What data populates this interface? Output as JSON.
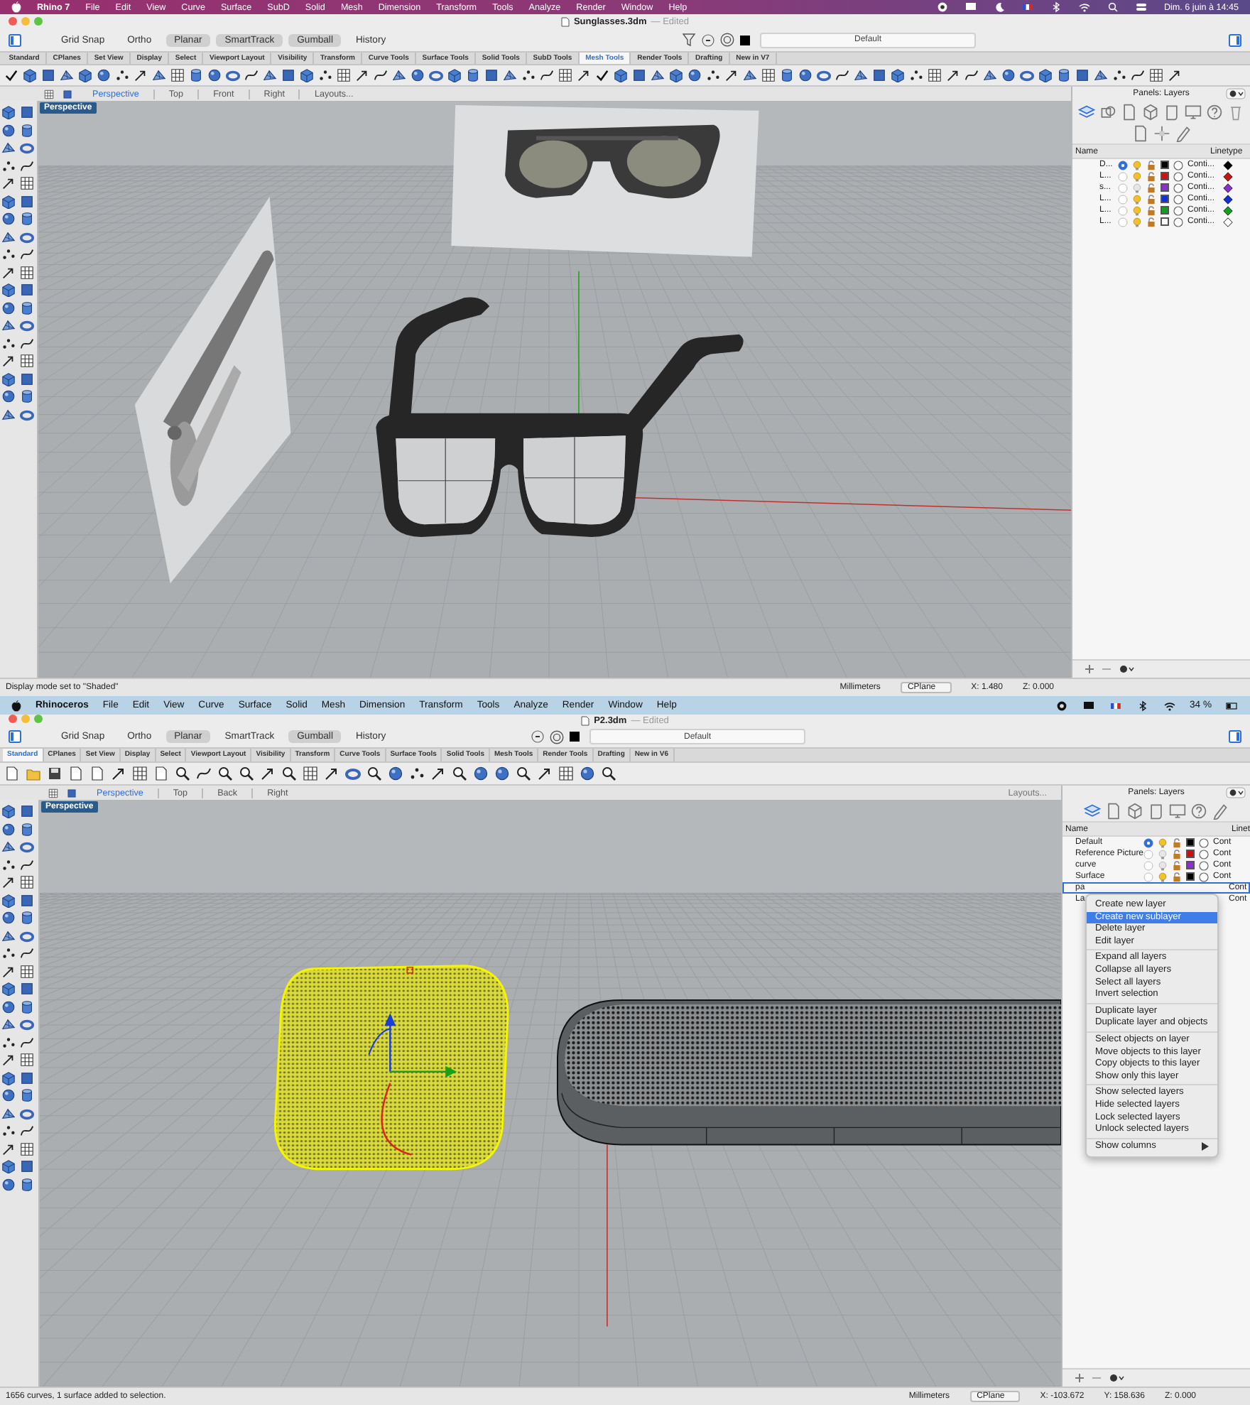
{
  "windows": [
    {
      "kind": "rhino7",
      "menu_bar": {
        "items": [
          "Rhino 7",
          "File",
          "Edit",
          "View",
          "Curve",
          "Surface",
          "SubD",
          "Solid",
          "Mesh",
          "Dimension",
          "Transform",
          "Tools",
          "Analyze",
          "Render",
          "Window",
          "Help"
        ],
        "clock": "Dim. 6 juin à 14:45"
      },
      "title": "Sunglasses.3dm",
      "title_note": "— Edited",
      "toggles": [
        {
          "label": "Grid Snap",
          "on": false
        },
        {
          "label": "Ortho",
          "on": false
        },
        {
          "label": "Planar",
          "on": true
        },
        {
          "label": "SmartTrack",
          "on": true
        },
        {
          "label": "Gumball",
          "on": true
        },
        {
          "label": "History",
          "on": false
        }
      ],
      "layer_field": "Default",
      "toolbar_tabs": [
        {
          "label": "Standard",
          "selected": false
        },
        {
          "label": "CPlanes",
          "selected": false
        },
        {
          "label": "Set View",
          "selected": false
        },
        {
          "label": "Display",
          "selected": false
        },
        {
          "label": "Select",
          "selected": false
        },
        {
          "label": "Viewport Layout",
          "selected": false
        },
        {
          "label": "Visibility",
          "selected": false
        },
        {
          "label": "Transform",
          "selected": false
        },
        {
          "label": "Curve Tools",
          "selected": false
        },
        {
          "label": "Surface Tools",
          "selected": false
        },
        {
          "label": "Solid Tools",
          "selected": false
        },
        {
          "label": "SubD Tools",
          "selected": false
        },
        {
          "label": "Mesh Tools",
          "selected": true
        },
        {
          "label": "Render Tools",
          "selected": false
        },
        {
          "label": "Drafting",
          "selected": false
        },
        {
          "label": "New in V7",
          "selected": false
        }
      ],
      "view_tabs": [
        {
          "label": "Perspective",
          "selected": true
        },
        {
          "label": "Top",
          "selected": false
        },
        {
          "label": "Front",
          "selected": false
        },
        {
          "label": "Right",
          "selected": false
        }
      ],
      "layouts_button": "Layouts...",
      "viewport": {
        "label": "Perspective",
        "kind": "glasses"
      },
      "panel": {
        "title": "Panels: Layers",
        "columns": [
          "Name",
          "Linetype"
        ],
        "rows": [
          {
            "name": "D...",
            "current": true,
            "visible": true,
            "color": "#000000",
            "linetype": "Conti..."
          },
          {
            "name": "L...",
            "current": false,
            "visible": true,
            "color": "#d01010",
            "linetype": "Conti..."
          },
          {
            "name": "s...",
            "current": false,
            "visible": false,
            "color": "#8a2fd0",
            "linetype": "Conti..."
          },
          {
            "name": "L...",
            "current": false,
            "visible": true,
            "color": "#1030e0",
            "linetype": "Conti..."
          },
          {
            "name": "L...",
            "current": false,
            "visible": true,
            "color": "#10a020",
            "linetype": "Conti..."
          },
          {
            "name": "L...",
            "current": false,
            "visible": true,
            "color": "#ffffff",
            "linetype": "Conti..."
          }
        ]
      },
      "status": {
        "message": "Display mode set to \"Shaded\"",
        "units": "Millimeters",
        "cplane": "CPlane",
        "coords": [
          "X: 1.480",
          "Z: 0.000"
        ]
      }
    },
    {
      "kind": "rhino6",
      "menu_bar": {
        "items": [
          "Rhinoceros",
          "File",
          "Edit",
          "View",
          "Curve",
          "Surface",
          "Solid",
          "Mesh",
          "Dimension",
          "Transform",
          "Tools",
          "Analyze",
          "Render",
          "Window",
          "Help"
        ],
        "battery": "34 %"
      },
      "title": "P2.3dm",
      "title_note": "— Edited",
      "toggles": [
        {
          "label": "Grid Snap",
          "on": false
        },
        {
          "label": "Ortho",
          "on": false
        },
        {
          "label": "Planar",
          "on": true
        },
        {
          "label": "SmartTrack",
          "on": false
        },
        {
          "label": "Gumball",
          "on": true
        },
        {
          "label": "History",
          "on": false
        }
      ],
      "layer_field": "Default",
      "toolbar_tabs": [
        {
          "label": "Standard",
          "selected": true
        },
        {
          "label": "CPlanes",
          "selected": false
        },
        {
          "label": "Set View",
          "selected": false
        },
        {
          "label": "Display",
          "selected": false
        },
        {
          "label": "Select",
          "selected": false
        },
        {
          "label": "Viewport Layout",
          "selected": false
        },
        {
          "label": "Visibility",
          "selected": false
        },
        {
          "label": "Transform",
          "selected": false
        },
        {
          "label": "Curve Tools",
          "selected": false
        },
        {
          "label": "Surface Tools",
          "selected": false
        },
        {
          "label": "Solid Tools",
          "selected": false
        },
        {
          "label": "Mesh Tools",
          "selected": false
        },
        {
          "label": "Render Tools",
          "selected": false
        },
        {
          "label": "Drafting",
          "selected": false
        },
        {
          "label": "New in V6",
          "selected": false
        }
      ],
      "view_tabs": [
        {
          "label": "Perspective",
          "selected": true
        },
        {
          "label": "Top",
          "selected": false
        },
        {
          "label": "Back",
          "selected": false
        },
        {
          "label": "Right",
          "selected": false
        }
      ],
      "layouts_button": "Layouts...",
      "viewport": {
        "label": "Perspective",
        "kind": "speaker"
      },
      "panel": {
        "title": "Panels: Layers",
        "columns": [
          "Name",
          "Linet"
        ],
        "rows": [
          {
            "kind": "full",
            "name": "Default",
            "selected": false,
            "current": true,
            "visible": true,
            "color": "#000000",
            "linetype": "Cont"
          },
          {
            "kind": "full",
            "name": "Reference Picture",
            "selected": false,
            "current": false,
            "visible": false,
            "color": "#d01010",
            "linetype": "Cont"
          },
          {
            "kind": "full",
            "name": "curve",
            "selected": false,
            "current": false,
            "visible": false,
            "color": "#8a2fd0",
            "linetype": "Cont"
          },
          {
            "kind": "full",
            "name": "Surface",
            "selected": false,
            "current": false,
            "visible": true,
            "color": "#000000",
            "linetype": "Cont"
          },
          {
            "kind": "covered",
            "name": "pa",
            "selected": true,
            "linetype": "Cont"
          },
          {
            "kind": "covered",
            "name": "La",
            "selected": false,
            "linetype": "Cont"
          }
        ],
        "context_menu": {
          "groups": [
            [
              {
                "label": "Create new layer",
                "selected": false,
                "kind": "item"
              },
              {
                "label": "Create new sublayer",
                "selected": true,
                "kind": "item"
              },
              {
                "label": "Delete layer",
                "selected": false,
                "kind": "item"
              },
              {
                "label": "Edit layer",
                "selected": false,
                "kind": "item"
              }
            ],
            [
              {
                "label": "Expand all layers",
                "selected": false,
                "kind": "item"
              },
              {
                "label": "Collapse all layers",
                "selected": false,
                "kind": "item"
              },
              {
                "label": "Select all layers",
                "selected": false,
                "kind": "item"
              },
              {
                "label": "Invert selection",
                "selected": false,
                "kind": "item"
              }
            ],
            [
              {
                "label": "Duplicate layer",
                "selected": false,
                "kind": "item"
              },
              {
                "label": "Duplicate layer and objects",
                "selected": false,
                "kind": "item"
              }
            ],
            [
              {
                "label": "Select objects on layer",
                "selected": false,
                "kind": "item"
              },
              {
                "label": "Move objects to this layer",
                "selected": false,
                "kind": "item"
              },
              {
                "label": "Copy objects to this layer",
                "selected": false,
                "kind": "item"
              },
              {
                "label": "Show only this layer",
                "selected": false,
                "kind": "item"
              }
            ],
            [
              {
                "label": "Show selected layers",
                "selected": false,
                "kind": "item"
              },
              {
                "label": "Hide selected layers",
                "selected": false,
                "kind": "item"
              },
              {
                "label": "Lock selected layers",
                "selected": false,
                "kind": "item"
              },
              {
                "label": "Unlock selected layers",
                "selected": false,
                "kind": "item"
              }
            ],
            [
              {
                "label": "Show columns",
                "selected": false,
                "kind": "submenu"
              }
            ]
          ]
        }
      },
      "status": {
        "message": "1656 curves, 1 surface added to selection.",
        "units": "Millimeters",
        "cplane": "CPlane",
        "coords": [
          "X: -103.672",
          "Y: 158.636",
          "Z: 0.000"
        ]
      }
    }
  ]
}
